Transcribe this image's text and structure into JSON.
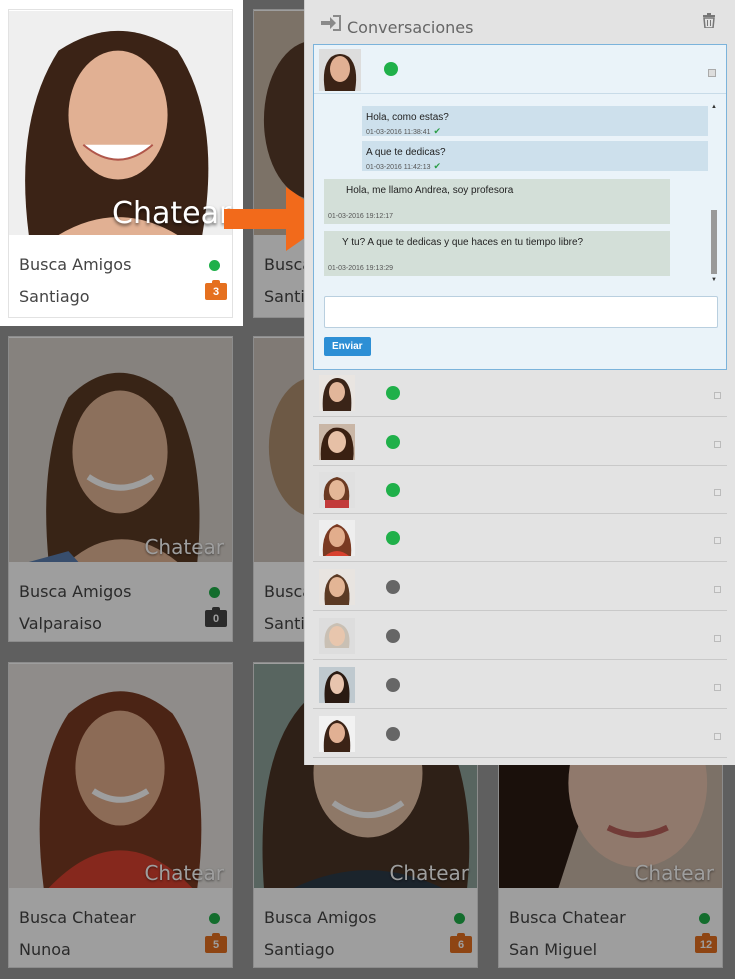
{
  "cards": [
    {
      "type": "Busca Amigos",
      "city": "Santiago",
      "count": "3",
      "chatear": "",
      "online": true,
      "badge_color": "#e5701f"
    },
    {
      "type": "Busca Amigos",
      "city": "Valparaiso",
      "count": "0",
      "chatear": "Chatear",
      "online": true,
      "badge_color": "#444444"
    },
    {
      "type": "Busca Chatear",
      "city": "Nunoa",
      "count": "5",
      "chatear": "Chatear",
      "online": true,
      "badge_color": "#e5701f"
    },
    {
      "type": "Busca Amigos",
      "city": "Santiago",
      "count": "6",
      "chatear": "Chatear",
      "online": true,
      "badge_color": "#e5701f"
    },
    {
      "type": "Busca Chatear",
      "city": "San Miguel",
      "count": "12",
      "chatear": "Chatear",
      "online": true,
      "badge_color": "#e5701f"
    },
    {
      "type": "Busca",
      "city": "Santia",
      "count": "",
      "chatear": "",
      "online": false,
      "badge_color": ""
    },
    {
      "type": "Busca",
      "city": "Santia",
      "count": "",
      "chatear": "",
      "online": false,
      "badge_color": ""
    }
  ],
  "overlay_label": "Chatear",
  "panel": {
    "title": "Conversaciones",
    "messages": [
      {
        "text": "Hola, como estas?",
        "time": "01-03-2016 11:38:41",
        "dir": "out"
      },
      {
        "text": "A que te dedicas?",
        "time": "01-03-2016 11:42:13",
        "dir": "out"
      },
      {
        "text": "Hola, me llamo Andrea, soy profesora",
        "time": "01-03-2016 19:12:17",
        "dir": "in"
      },
      {
        "text": "Y tu? A que te dedicas y que haces en tu tiempo libre?",
        "time": "01-03-2016 19:13:29",
        "dir": "in"
      }
    ],
    "input_placeholder": "",
    "send_label": "Enviar",
    "list": [
      {
        "status": "online"
      },
      {
        "status": "online"
      },
      {
        "status": "online"
      },
      {
        "status": "online"
      },
      {
        "status": "offline"
      },
      {
        "status": "offline"
      },
      {
        "status": "offline"
      },
      {
        "status": "offline"
      }
    ]
  },
  "colors": {
    "online": "#20b04a",
    "offline": "#666666",
    "accent": "#e5701f",
    "send_button": "#2d8fd5"
  }
}
